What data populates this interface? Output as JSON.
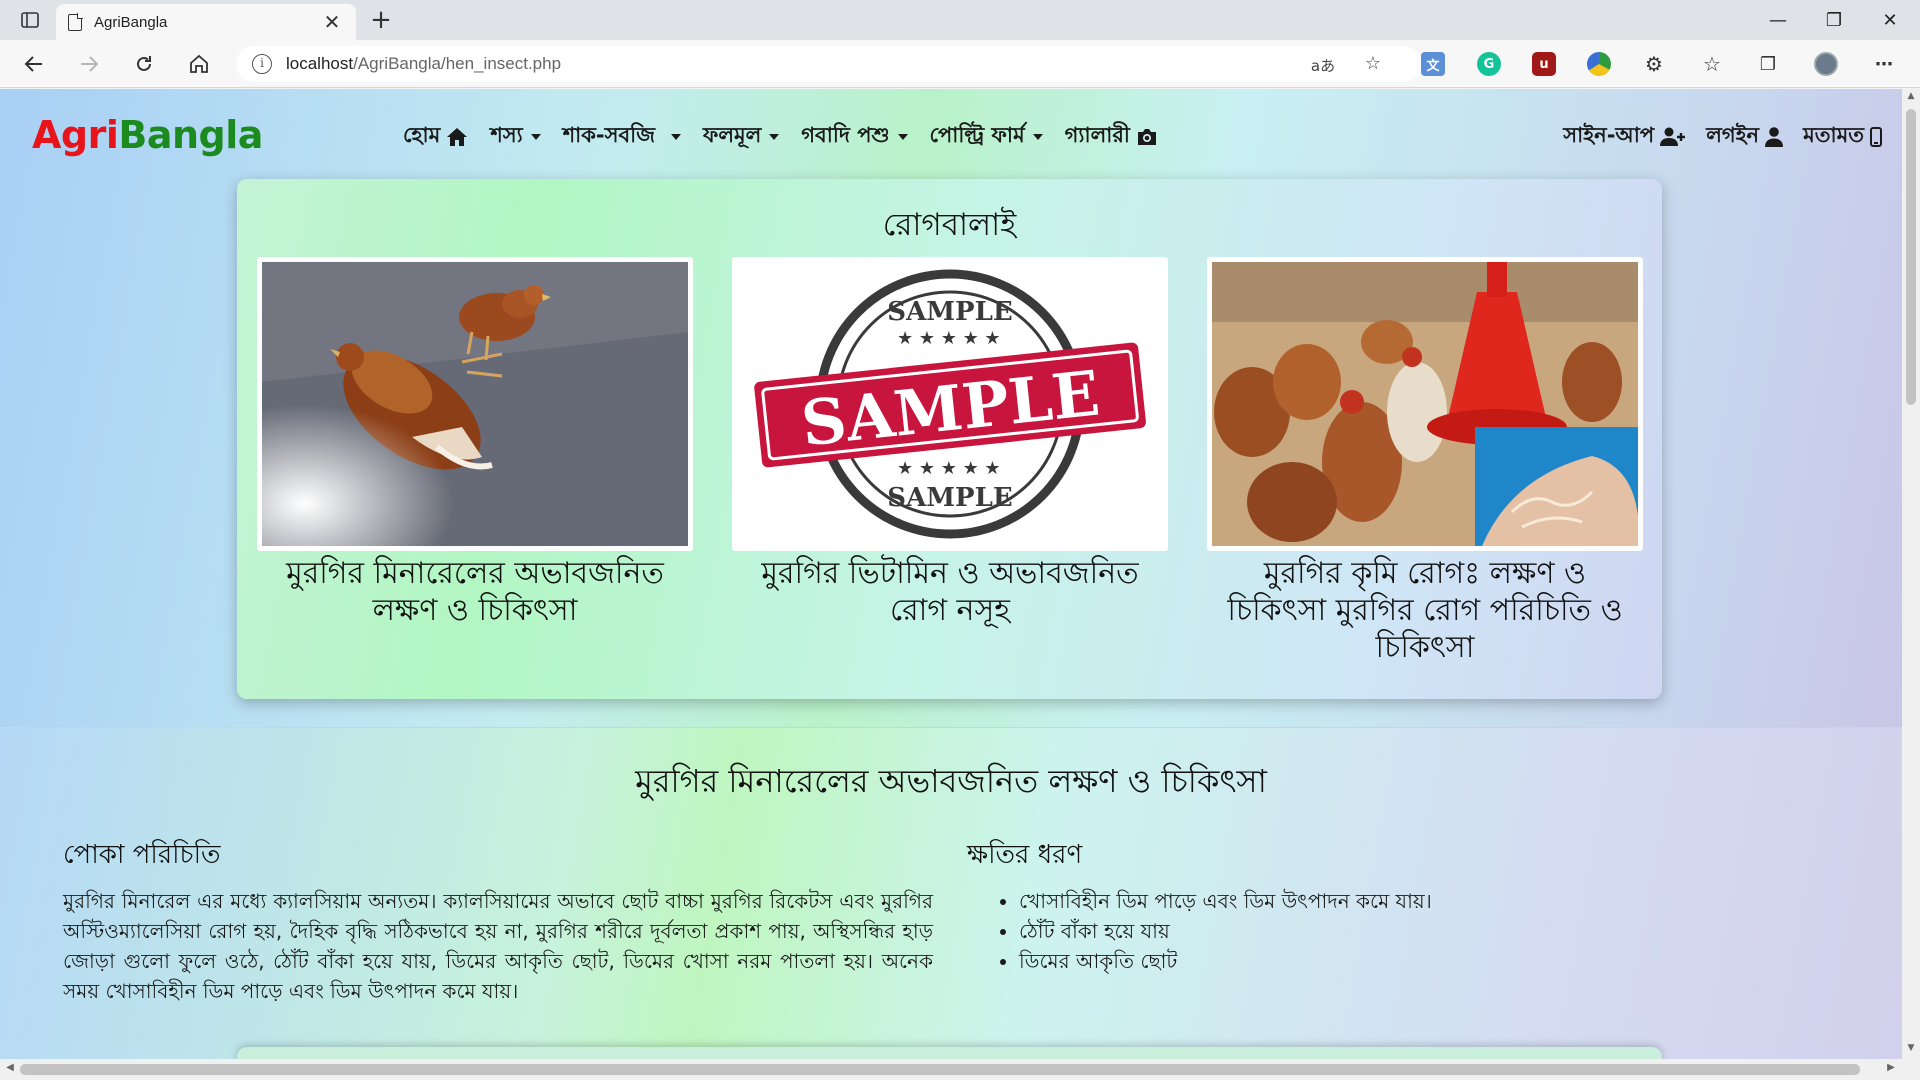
{
  "browser": {
    "tab_title": "AgriBangla",
    "tab_close": "✕",
    "new_tab": "+",
    "url_host": "localhost",
    "url_path": "/AgriBangla/hen_insect.php",
    "read_aloud": "aあ",
    "win_minimize": "—",
    "win_restore": "❐",
    "win_close": "✕"
  },
  "site": {
    "brand_part1": "Agri",
    "brand_part2": "Bangla",
    "brand_colors": {
      "part1": "#e8141b",
      "part2": "#1b8a1f"
    },
    "menu": [
      {
        "label": "হোম",
        "icon": "home-icon"
      },
      {
        "label": "শস্য",
        "icon": "caret-down-icon"
      },
      {
        "label": "শাক-সবজি",
        "icon": "caret-down-icon"
      },
      {
        "label": "ফলমূল",
        "icon": "caret-down-icon"
      },
      {
        "label": "গবাদি পশু",
        "icon": "caret-down-icon"
      },
      {
        "label": "পোল্ট্রি ফার্ম",
        "icon": "caret-down-icon"
      },
      {
        "label": "গ্যালারী",
        "icon": "camera-icon"
      }
    ],
    "right_menu": [
      {
        "label": "সাইন-আপ",
        "icon": "user-plus-icon"
      },
      {
        "label": "লগইন",
        "icon": "user-icon"
      },
      {
        "label": "মতামত",
        "icon": "mobile-icon"
      }
    ]
  },
  "gallery": {
    "title": "রোগবালাই",
    "cards": [
      {
        "caption": "মুরগির মিনারেলের অভাবজনিত লক্ষণ ও চিকিৎসা",
        "image": "sick-chickens-photo"
      },
      {
        "caption": "মুরগির ভিটামিন ও অভাবজনিত রোগ নসূহ",
        "image": "sample-stamp-image",
        "stamp_big": "SAMPLE",
        "stamp_small": "SAMPLE"
      },
      {
        "caption": "মুরগির কৃমি রোগঃ লক্ষণ ও চিকিৎসা মুরগির রোগ পরিচিতি ও চিকিৎসা",
        "image": "hens-feeder-worms-photo"
      }
    ]
  },
  "article": {
    "title": "মুরগির মিনারেলের অভাবজনিত লক্ষণ ও চিকিৎসা",
    "left_heading": "পোকা পরিচিতি",
    "left_text": "মুরগির মিনারেল এর মধ্যে ক্যালসিয়াম অন্যতম। ক্যালসিয়ামের অভাবে ছোট বাচ্চা মুরগির রিকেটস এবং মুরগির অস্টিওম্যালেসিয়া রোগ হয়, দৈহিক বৃদ্ধি সঠিকভাবে হয় না, মুরগির শরীরে দূর্বলতা প্রকাশ পায়, অস্থিসন্ধির হাড় জোড়া গুলো ফুলে ওঠে, ঠোঁট বাঁকা হয়ে যায়, ডিমের আকৃতি ছোট, ডিমের খোসা নরম পাতলা হয়। অনেক সময় খোসাবিহীন ডিম পাড়ে এবং ডিম উৎপাদন কমে যায়।",
    "right_heading": "ক্ষতির ধরণ",
    "right_items": [
      "খোসাবিহীন ডিম পাড়ে এবং ডিম উৎপাদন কমে যায়।",
      "ঠোঁট বাঁকা হয়ে যায়",
      "ডিমের আকৃতি ছোট"
    ]
  }
}
